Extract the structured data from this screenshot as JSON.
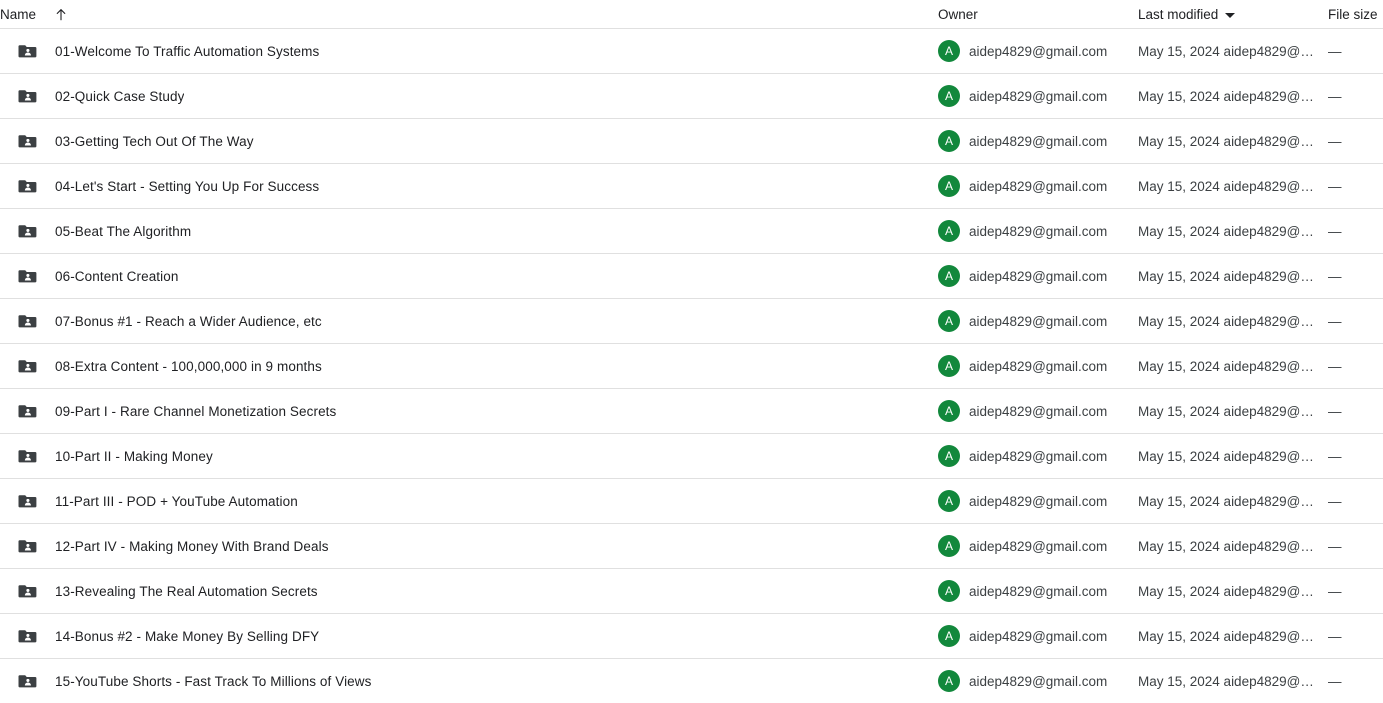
{
  "view": {
    "app": "Google Drive",
    "layout": "list"
  },
  "columns": {
    "name": "Name",
    "owner": "Owner",
    "last_modified": "Last modified",
    "file_size": "File size",
    "sort_icon": "arrow-up-icon",
    "sort_direction": "ascending",
    "last_modified_caret": "chevron-down-icon"
  },
  "colors": {
    "avatar_green": "#12883c",
    "folder_gray": "#3c4043",
    "divider": "#e0e0e0",
    "text_primary": "#202124",
    "text_secondary": "#3c4043"
  },
  "rows": [
    {
      "icon": "shared-folder-icon",
      "name": "01-Welcome To Traffic Automation Systems",
      "owner_initial": "A",
      "owner": "aidep4829@gmail.com",
      "last_modified": "May 15, 2024 aidep4829@g...",
      "file_size": "—"
    },
    {
      "icon": "shared-folder-icon",
      "name": "02-Quick Case Study",
      "owner_initial": "A",
      "owner": "aidep4829@gmail.com",
      "last_modified": "May 15, 2024 aidep4829@g...",
      "file_size": "—"
    },
    {
      "icon": "shared-folder-icon",
      "name": "03-Getting Tech Out Of The Way",
      "owner_initial": "A",
      "owner": "aidep4829@gmail.com",
      "last_modified": "May 15, 2024 aidep4829@g...",
      "file_size": "—"
    },
    {
      "icon": "shared-folder-icon",
      "name": "04-Let's Start - Setting You Up For Success",
      "owner_initial": "A",
      "owner": "aidep4829@gmail.com",
      "last_modified": "May 15, 2024 aidep4829@g...",
      "file_size": "—"
    },
    {
      "icon": "shared-folder-icon",
      "name": "05-Beat The Algorithm",
      "owner_initial": "A",
      "owner": "aidep4829@gmail.com",
      "last_modified": "May 15, 2024 aidep4829@g...",
      "file_size": "—"
    },
    {
      "icon": "shared-folder-icon",
      "name": "06-Content Creation",
      "owner_initial": "A",
      "owner": "aidep4829@gmail.com",
      "last_modified": "May 15, 2024 aidep4829@g...",
      "file_size": "—"
    },
    {
      "icon": "shared-folder-icon",
      "name": "07-Bonus #1 - Reach a Wider Audience, etc",
      "owner_initial": "A",
      "owner": "aidep4829@gmail.com",
      "last_modified": "May 15, 2024 aidep4829@g...",
      "file_size": "—"
    },
    {
      "icon": "shared-folder-icon",
      "name": "08-Extra Content - 100,000,000 in 9 months",
      "owner_initial": "A",
      "owner": "aidep4829@gmail.com",
      "last_modified": "May 15, 2024 aidep4829@g...",
      "file_size": "—"
    },
    {
      "icon": "shared-folder-icon",
      "name": "09-Part I - Rare Channel Monetization Secrets",
      "owner_initial": "A",
      "owner": "aidep4829@gmail.com",
      "last_modified": "May 15, 2024 aidep4829@g...",
      "file_size": "—"
    },
    {
      "icon": "shared-folder-icon",
      "name": "10-Part II - Making Money",
      "owner_initial": "A",
      "owner": "aidep4829@gmail.com",
      "last_modified": "May 15, 2024 aidep4829@g...",
      "file_size": "—"
    },
    {
      "icon": "shared-folder-icon",
      "name": "11-Part III - POD + YouTube Automation",
      "owner_initial": "A",
      "owner": "aidep4829@gmail.com",
      "last_modified": "May 15, 2024 aidep4829@g...",
      "file_size": "—"
    },
    {
      "icon": "shared-folder-icon",
      "name": "12-Part IV - Making Money With Brand Deals",
      "owner_initial": "A",
      "owner": "aidep4829@gmail.com",
      "last_modified": "May 15, 2024 aidep4829@g...",
      "file_size": "—"
    },
    {
      "icon": "shared-folder-icon",
      "name": "13-Revealing The Real Automation Secrets",
      "owner_initial": "A",
      "owner": "aidep4829@gmail.com",
      "last_modified": "May 15, 2024 aidep4829@g...",
      "file_size": "—"
    },
    {
      "icon": "shared-folder-icon",
      "name": "14-Bonus #2 - Make Money By Selling DFY",
      "owner_initial": "A",
      "owner": "aidep4829@gmail.com",
      "last_modified": "May 15, 2024 aidep4829@g...",
      "file_size": "—"
    },
    {
      "icon": "shared-folder-icon",
      "name": "15-YouTube Shorts - Fast Track To Millions of Views",
      "owner_initial": "A",
      "owner": "aidep4829@gmail.com",
      "last_modified": "May 15, 2024 aidep4829@g...",
      "file_size": "—"
    }
  ]
}
